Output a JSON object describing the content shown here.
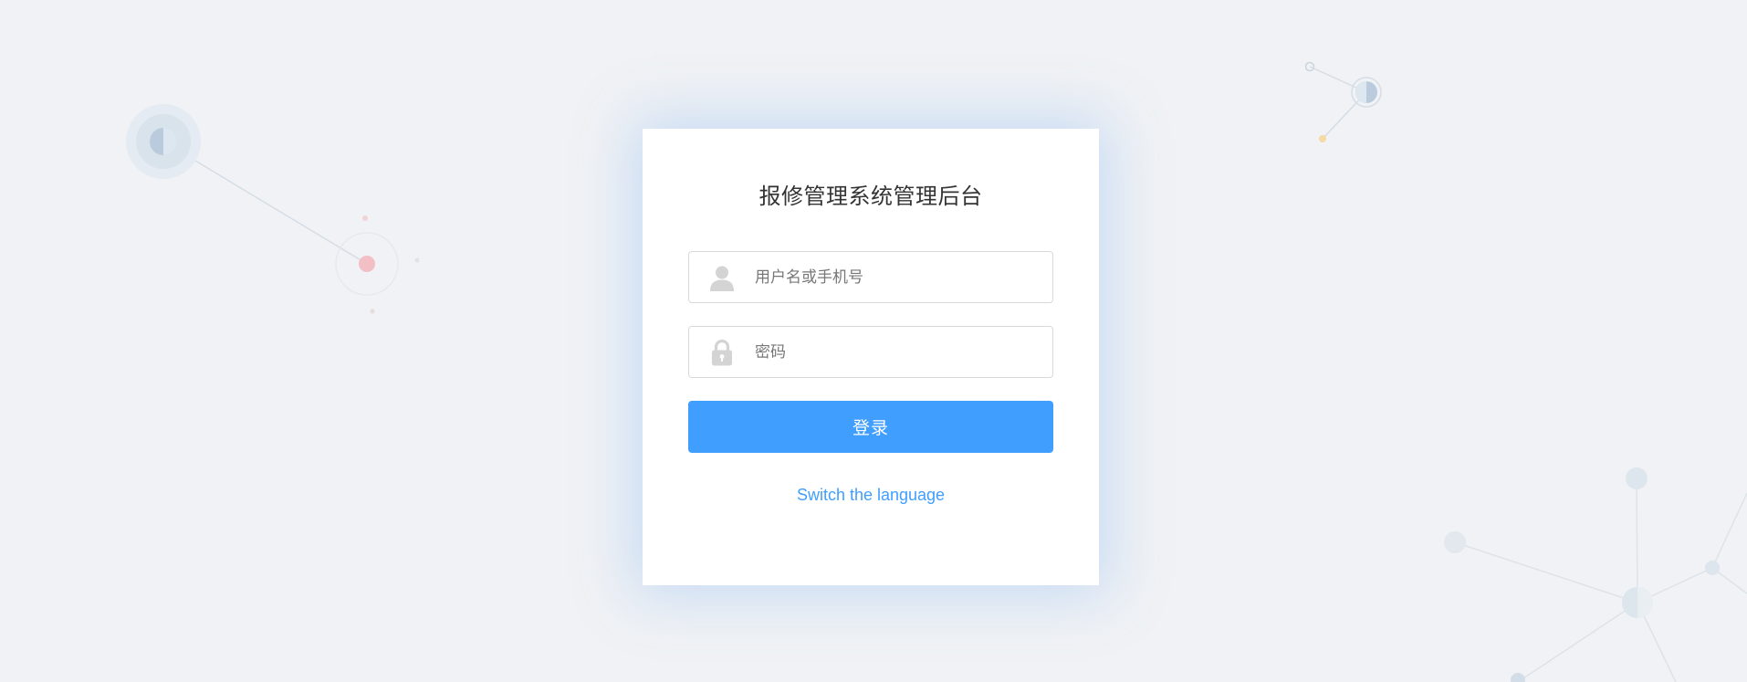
{
  "page": {
    "background_color": "#f0f2f5",
    "accent_color": "#409eff"
  },
  "login": {
    "title": "报修管理系统管理后台",
    "username": {
      "icon": "user-icon",
      "placeholder": "用户名或手机号",
      "value": ""
    },
    "password": {
      "icon": "lock-icon",
      "placeholder": "密码",
      "value": ""
    },
    "submit_label": "登录",
    "switch_language_label": "Switch the language"
  },
  "decor": {
    "node_colors": {
      "blue_grey": "#b9cbdc",
      "pale_blue": "#dde7f0",
      "pink": "#f2c0c4",
      "yellow": "#f7d9a4",
      "line": "#d5dde6"
    }
  }
}
